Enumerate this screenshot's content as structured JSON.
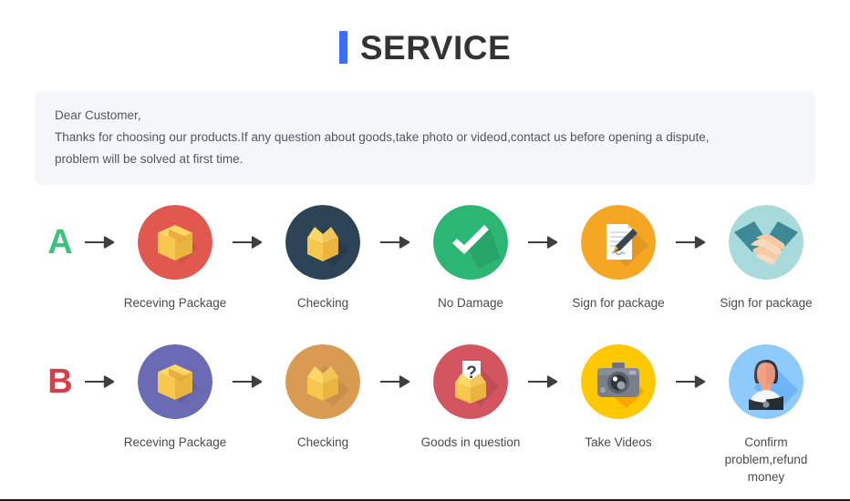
{
  "header": {
    "accent_color": "#3b6ef5",
    "title": "SERVICE"
  },
  "notice": {
    "line1": "Dear Customer,",
    "line2": "Thanks for choosing our products.If any question about goods,take photo or videod,contact us before opening a dispute,",
    "line3": "problem will be solved at first time.",
    "background_color": "#f5f6fa"
  },
  "flows": [
    {
      "letter": "A",
      "letter_color": "#3ec17c",
      "steps": [
        {
          "label": "Receving Package",
          "icon": "closed-box-icon",
          "circle_color": "#e0584e"
        },
        {
          "label": "Checking",
          "icon": "open-box-icon",
          "circle_color": "#2d4356"
        },
        {
          "label": "No Damage",
          "icon": "check-mark-icon",
          "circle_color": "#2bb673"
        },
        {
          "label": "Sign for package",
          "icon": "document-pen-icon",
          "circle_color": "#f5a623"
        },
        {
          "label": "Sign for package",
          "icon": "handshake-icon",
          "circle_color": "#a8dadc"
        }
      ]
    },
    {
      "letter": "B",
      "letter_color": "#dc3c46",
      "steps": [
        {
          "label": "Receving Package",
          "icon": "closed-box-icon",
          "circle_color": "#6b6bb5"
        },
        {
          "label": "Checking",
          "icon": "open-box-icon",
          "circle_color": "#d99a52"
        },
        {
          "label": "Goods in question",
          "icon": "question-box-icon",
          "circle_color": "#d2555f"
        },
        {
          "label": "Take Videos",
          "icon": "camera-icon",
          "circle_color": "#ffc800"
        },
        {
          "label": "Confirm problem,refund money",
          "icon": "person-icon",
          "circle_color": "#8ecafc"
        }
      ]
    }
  ],
  "arrow": {
    "icon": "arrow-right-icon",
    "color": "#3f3f3f"
  }
}
